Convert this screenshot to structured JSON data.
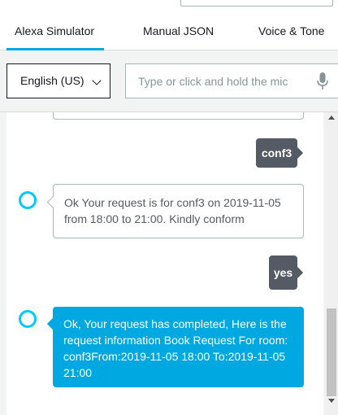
{
  "tabs": [
    {
      "label": "Alexa Simulator",
      "active": true
    },
    {
      "label": "Manual JSON",
      "active": false
    },
    {
      "label": "Voice & Tone",
      "active": false
    }
  ],
  "controls": {
    "language": "English (US)",
    "utterance_placeholder": "Type or click and hold the mic",
    "mic_icon": "microphone-icon"
  },
  "messages": [
    {
      "from": "user",
      "text": "conf3"
    },
    {
      "from": "alexa",
      "text": "Ok Your request is for conf3 on 2019-11-05 from 18:00 to 21:00. Kindly conform"
    },
    {
      "from": "user",
      "text": "yes"
    },
    {
      "from": "alexa",
      "text": "Ok, Your request has completed, Here is the request information Book Request For room: conf3From:2019-11-05 18:00 To:2019-11-05 21:00"
    }
  ],
  "colors": {
    "accent": "#00a8e1",
    "user_bubble": "#545b64",
    "avatar_ring": "#00caff"
  }
}
